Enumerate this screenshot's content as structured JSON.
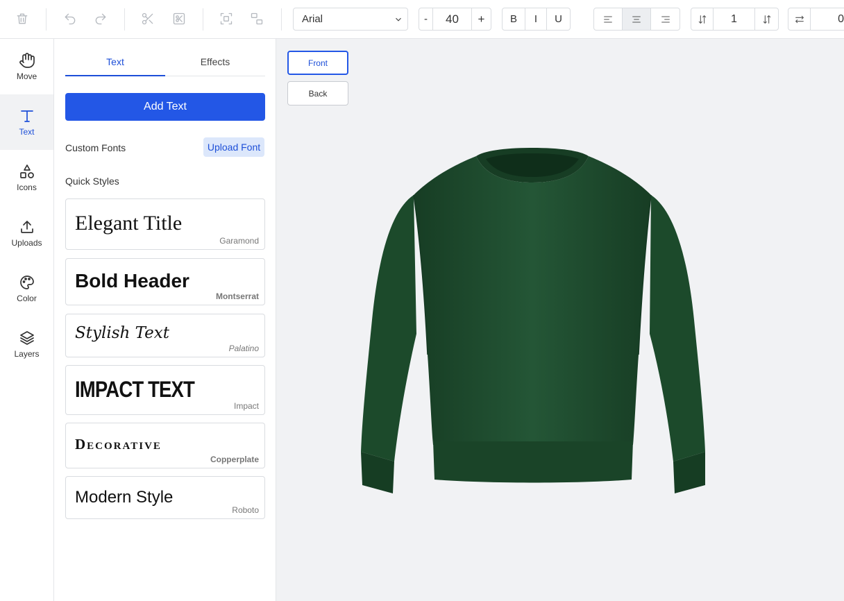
{
  "toolbar": {
    "font_family": "Arial",
    "font_size": "40",
    "decrease_label": "-",
    "increase_label": "+",
    "bold_label": "B",
    "italic_label": "I",
    "underline_label": "U",
    "line_height": "1",
    "letter_spacing": "0"
  },
  "sidebar": {
    "items": [
      {
        "label": "Move",
        "icon": "hand-icon"
      },
      {
        "label": "Text",
        "icon": "text-icon"
      },
      {
        "label": "Icons",
        "icon": "shapes-icon"
      },
      {
        "label": "Uploads",
        "icon": "upload-icon"
      },
      {
        "label": "Color",
        "icon": "palette-icon"
      },
      {
        "label": "Layers",
        "icon": "layers-icon"
      }
    ],
    "active": "Text"
  },
  "panel": {
    "tabs": [
      {
        "label": "Text"
      },
      {
        "label": "Effects"
      }
    ],
    "add_text_label": "Add Text",
    "custom_fonts_label": "Custom Fonts",
    "upload_font_label": "Upload Font",
    "quick_styles_label": "Quick Styles",
    "styles": [
      {
        "sample": "Elegant Title",
        "font": "Garamond"
      },
      {
        "sample": "Bold Header",
        "font": "Montserrat"
      },
      {
        "sample": "Stylish Text",
        "font": "Palatino"
      },
      {
        "sample": "IMPACT TEXT",
        "font": "Impact"
      },
      {
        "sample": "Decorative",
        "font": "Copperplate"
      },
      {
        "sample": "Modern Style",
        "font": "Roboto"
      }
    ]
  },
  "canvas": {
    "front_label": "Front",
    "back_label": "Back",
    "product_color": "#1f4d2e"
  },
  "colors": {
    "accent": "#2357e6",
    "accent_light": "#dce7fb"
  }
}
